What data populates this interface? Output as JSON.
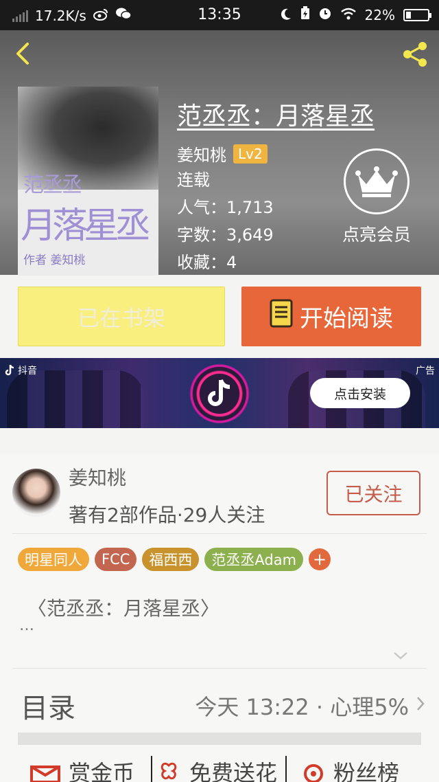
{
  "statusbar": {
    "speed": "17.2K/s",
    "time": "13:35",
    "battery": "22%"
  },
  "book": {
    "title": "范丞丞：月落星丞",
    "author": "姜知桃",
    "level": "Lv2",
    "status": "连载",
    "popularity": "人气：1,713",
    "words": "字数：3,649",
    "favorites": "收藏：4"
  },
  "cover": {
    "title_small": "范丞丞",
    "title_big": "月落星丞",
    "author_line": "作者 姜知桃"
  },
  "vip": {
    "label": "点亮会员"
  },
  "actions": {
    "shelf_label": "已在书架",
    "read_label": "开始阅读"
  },
  "ad": {
    "brand": "抖音",
    "tag": "广告",
    "install_label": "点击安装"
  },
  "author_card": {
    "name": "姜知桃",
    "stats": "著有2部作品·29人关注",
    "follow_label": "已关注"
  },
  "tags": [
    {
      "label": "明星同人",
      "color": "#f0a83a"
    },
    {
      "label": "FCC",
      "color": "#c2664f"
    },
    {
      "label": "福西西",
      "color": "#c8922d"
    },
    {
      "label": "范丞丞Adam",
      "color": "#8db04f"
    }
  ],
  "tag_add": "+",
  "intro": {
    "title": "〈范丞丞：月落星丞〉",
    "more": "…"
  },
  "toc": {
    "label": "目录",
    "update": "今天 13:22 · 心理5%"
  },
  "bottom_bar": {
    "coins": "赏金币",
    "flowers": "免费送花",
    "fans": "粉丝榜"
  },
  "colors": {
    "accent": "#e8673a",
    "shelf": "#f9ef7e",
    "level_badge": "#f0b441",
    "follow": "#c55b4a"
  }
}
